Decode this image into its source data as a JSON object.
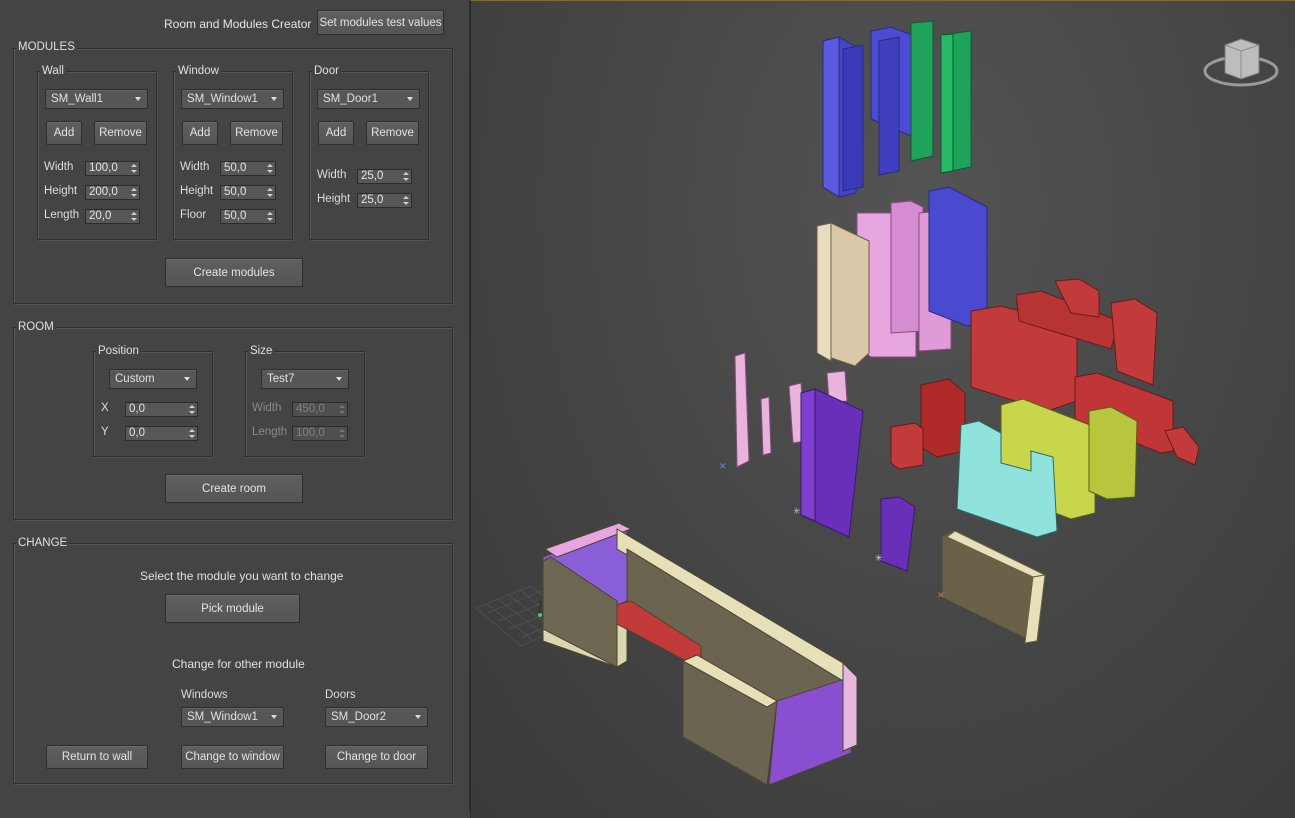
{
  "header": {
    "title": "Room and Modules Creator",
    "test_button": "Set modules test values"
  },
  "modules": {
    "label": "MODULES",
    "wall": {
      "label": "Wall",
      "selected": "SM_Wall1",
      "add": "Add",
      "remove": "Remove",
      "fields": [
        {
          "label": "Width",
          "value": "100,0"
        },
        {
          "label": "Height",
          "value": "200,0"
        },
        {
          "label": "Length",
          "value": "20,0"
        }
      ]
    },
    "window": {
      "label": "Window",
      "selected": "SM_Window1",
      "add": "Add",
      "remove": "Remove",
      "fields": [
        {
          "label": "Width",
          "value": "50,0"
        },
        {
          "label": "Height",
          "value": "50,0"
        },
        {
          "label": "Floor",
          "value": "50,0"
        }
      ]
    },
    "door": {
      "label": "Door",
      "selected": "SM_Door1",
      "add": "Add",
      "remove": "Remove",
      "fields": [
        {
          "label": "Width",
          "value": "25,0"
        },
        {
          "label": "Height",
          "value": "25,0"
        }
      ]
    },
    "create_button": "Create modules"
  },
  "room": {
    "label": "ROOM",
    "position": {
      "label": "Position",
      "selected": "Custom",
      "x_label": "X",
      "x_value": "0,0",
      "y_label": "Y",
      "y_value": "0,0"
    },
    "size": {
      "label": "Size",
      "selected": "Test7",
      "width_label": "Width",
      "width_value": "450,0",
      "length_label": "Length",
      "length_value": "100,0"
    },
    "create_button": "Create room"
  },
  "change": {
    "label": "CHANGE",
    "instruction": "Select the module you want to change",
    "pick_button": "Pick module",
    "other_label": "Change for other module",
    "windows_label": "Windows",
    "windows_selected": "SM_Window1",
    "doors_label": "Doors",
    "doors_selected": "SM_Door2",
    "return_button": "Return to wall",
    "change_window_button": "Change to window",
    "change_door_button": "Change to door"
  },
  "viewport": {
    "nav_cube_icon": "view-cube-icon",
    "colors": {
      "wall": "#dcd8b4",
      "blue": "#4a4ad0",
      "green": "#1fa35a",
      "pink": "#e8a6e0",
      "red": "#c33a3a",
      "yellow": "#c7d64a",
      "cyan": "#8fe3dc",
      "purple": "#7a3cc4"
    }
  }
}
